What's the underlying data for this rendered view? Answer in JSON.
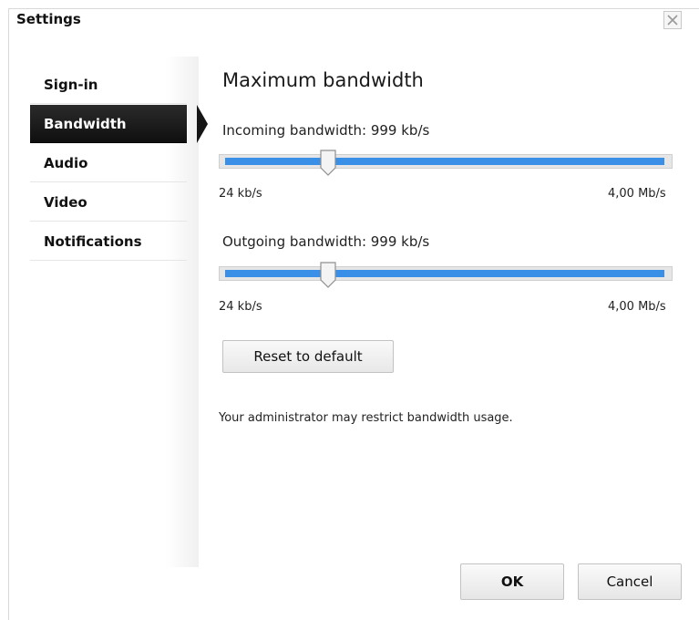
{
  "window": {
    "title": "Settings",
    "close_icon": "close-icon"
  },
  "sidebar": {
    "items": [
      {
        "label": "Sign-in",
        "active": false
      },
      {
        "label": "Bandwidth",
        "active": true
      },
      {
        "label": "Audio",
        "active": false
      },
      {
        "label": "Video",
        "active": false
      },
      {
        "label": "Notifications",
        "active": false
      }
    ]
  },
  "main": {
    "heading": "Maximum bandwidth",
    "incoming": {
      "label": "Incoming bandwidth: 999 kb/s",
      "value_fraction": 0.24,
      "min_label": "24 kb/s",
      "max_label": "4,00 Mb/s"
    },
    "outgoing": {
      "label": "Outgoing bandwidth: 999 kb/s",
      "value_fraction": 0.24,
      "min_label": "24 kb/s",
      "max_label": "4,00 Mb/s"
    },
    "reset_label": "Reset to default",
    "note": "Your administrator may restrict bandwidth usage."
  },
  "footer": {
    "ok_label": "OK",
    "cancel_label": "Cancel"
  },
  "colors": {
    "accent": "#3a8fe6",
    "active_nav": "#151515"
  }
}
